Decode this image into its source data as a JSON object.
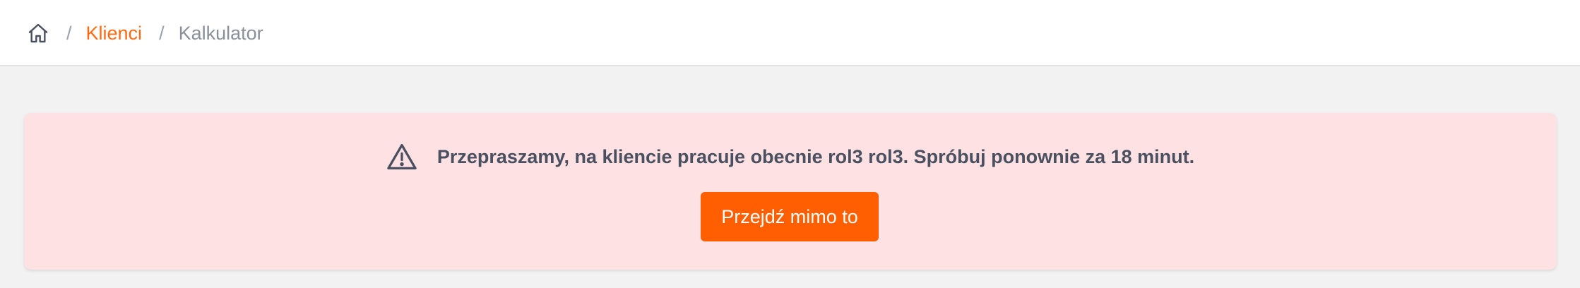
{
  "breadcrumb": {
    "home_icon": "home-icon",
    "separator": "/",
    "items": [
      {
        "label": "Klienci",
        "link": true
      },
      {
        "label": "Kalkulator",
        "link": false
      }
    ]
  },
  "alert": {
    "icon": "warning-triangle-icon",
    "message": "Przepraszamy, na kliencie pracuje obecnie rol3 rol3. Spróbuj ponownie za 18 minut.",
    "button_label": "Przejdź mimo to"
  },
  "colors": {
    "accent": "#ff5f00",
    "link": "#ff6a13",
    "alert_background": "#fde1e3",
    "page_background": "#f2f2f2"
  }
}
